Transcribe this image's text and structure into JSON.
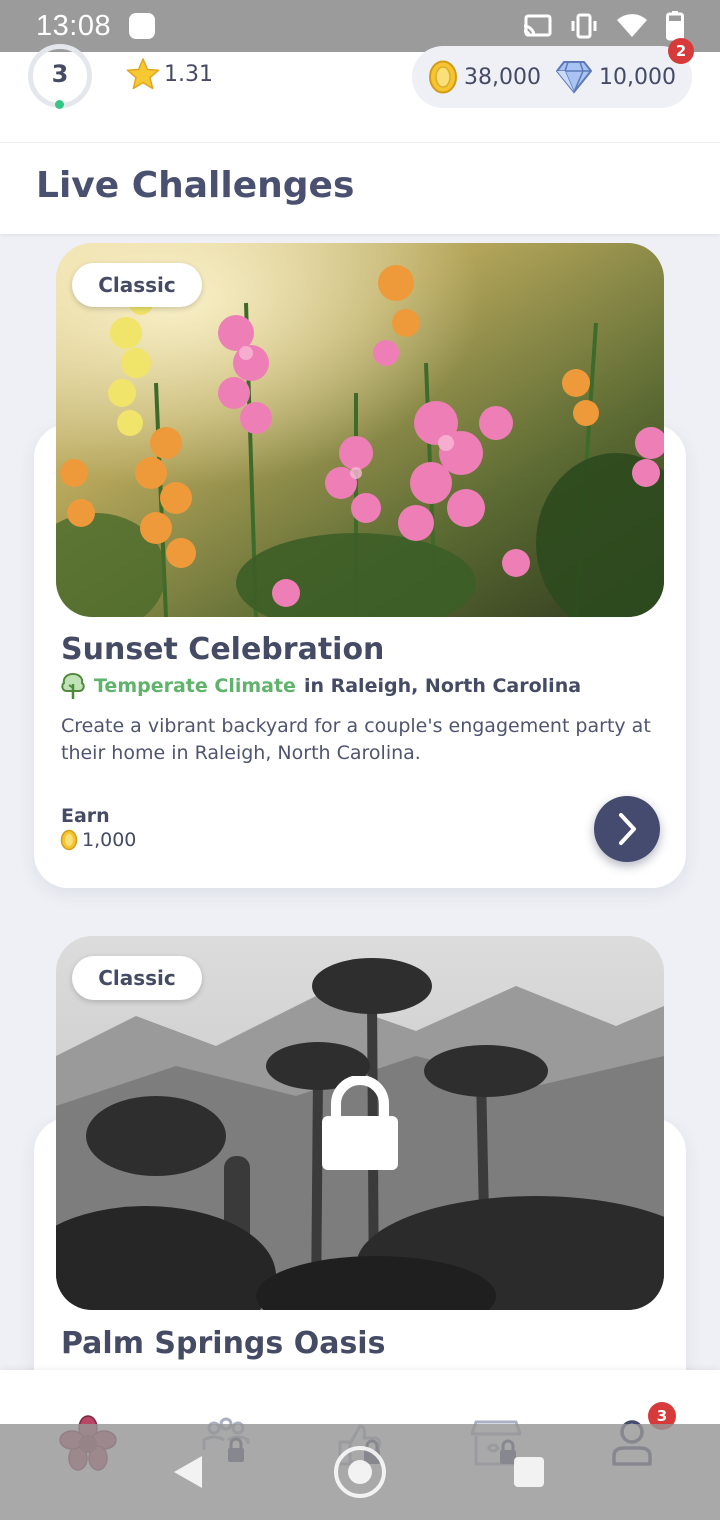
{
  "status_bar": {
    "time": "13:08"
  },
  "stats": {
    "level": "3",
    "rating": "1.31",
    "coins": "38,000",
    "gems": "10,000",
    "notification_count": "2"
  },
  "section": {
    "title": "Live Challenges"
  },
  "challenges": [
    {
      "mode": "Classic",
      "title": "Sunset Celebration",
      "climate": "Temperate Climate",
      "location": "in Raleigh, North Carolina",
      "description": "Create a vibrant backyard for a couple's engagement party at their home in Raleigh, North Carolina.",
      "earn_label": "Earn",
      "reward": "1,000",
      "locked": false
    },
    {
      "mode": "Classic",
      "title": "Palm Springs Oasis",
      "locked": true
    }
  ],
  "tab_bar": {
    "tabs": [
      "home",
      "community",
      "likes",
      "shop",
      "profile"
    ],
    "profile_badge": "3"
  },
  "colors": {
    "accent_dark": "#454b6e",
    "climate_green": "#5fb36a",
    "badge_red": "#d63a3a",
    "background": "#eef0f5"
  },
  "icons": [
    "cast-icon",
    "vibrate-icon",
    "wifi-icon",
    "battery-icon",
    "star-icon",
    "coin-icon",
    "gem-icon",
    "tree-icon",
    "chevron-right-icon",
    "lock-icon",
    "flower-logo-icon",
    "community-locked-icon",
    "thumbs-up-locked-icon",
    "shop-locked-icon",
    "profile-icon"
  ]
}
